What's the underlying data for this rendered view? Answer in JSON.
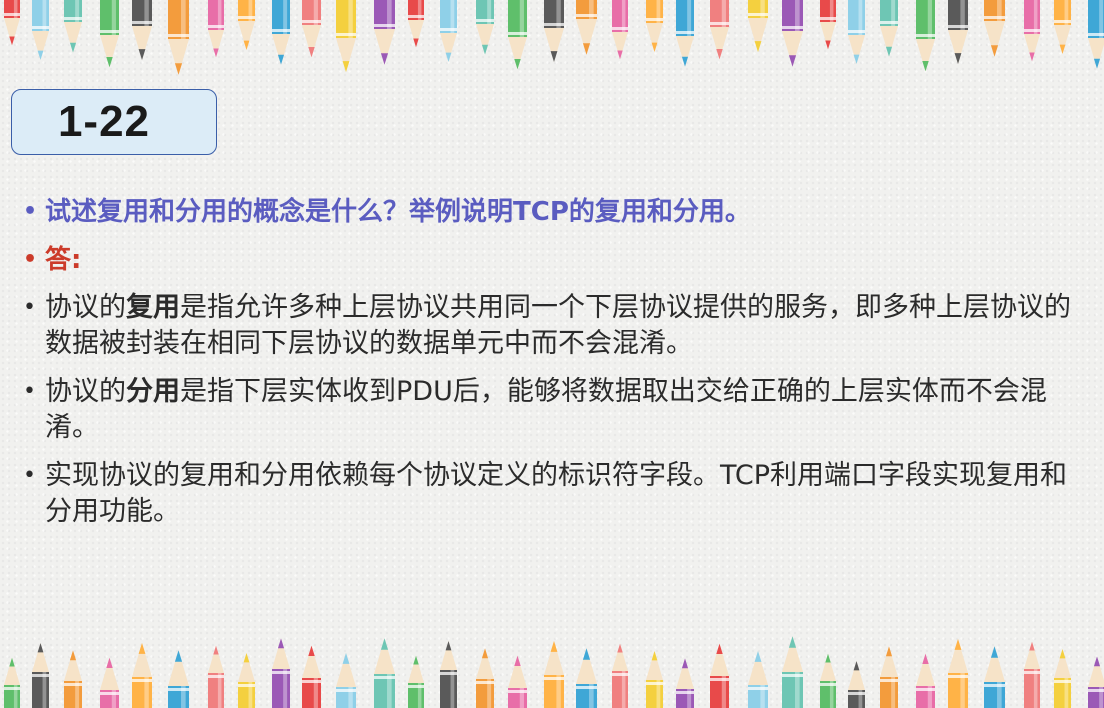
{
  "slide": {
    "number": "1-22"
  },
  "question": {
    "text": "试述复用和分用的概念是什么？举例说明TCP的复用和分用。"
  },
  "answer_label": "答:",
  "points": [
    {
      "prefix": "协议的",
      "keyword": "复用",
      "rest": "是指允许多种上层协议共用同一个下层协议提供的服务，即多种上层协议的数据被封装在相同下层协议的数据单元中而不会混淆。"
    },
    {
      "prefix": "协议的",
      "keyword": "分用",
      "rest": "是指下层实体收到PDU后，能够将数据取出交给正确的上层实体而不会混淆。"
    },
    {
      "text": "实现协议的复用和分用依赖每个协议定义的标识符字段。TCP利用端口字段实现复用和分用功能。"
    }
  ],
  "colors": {
    "question": "#5a5cc0",
    "answer_label": "#cc3b2a",
    "body_text": "#2b2b2b",
    "box_fill": "#dcecf7",
    "box_border": "#3a5ea8"
  },
  "decoration": {
    "top_border": "colored-pencils-pointing-down",
    "bottom_border": "colored-pencils-pointing-up"
  }
}
